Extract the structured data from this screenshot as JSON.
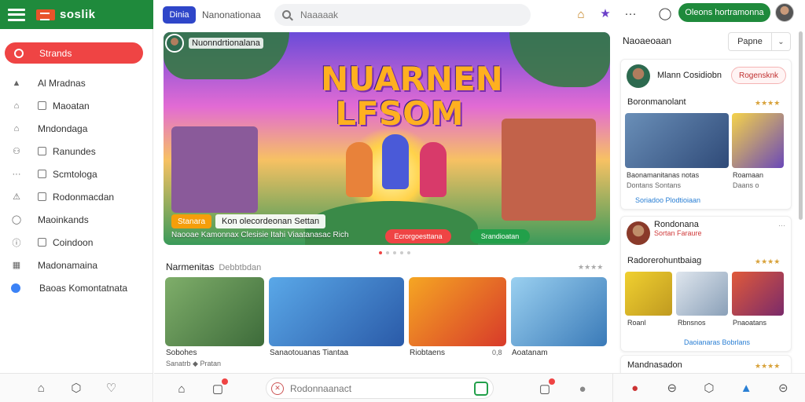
{
  "app": {
    "name": "soslik",
    "colors": {
      "brand_green": "#1f8a3c",
      "accent_red": "#ef4444",
      "accent_blue": "#2f46c9"
    }
  },
  "sidebar": {
    "active": {
      "label": "Strands",
      "icon": "home-icon"
    },
    "items": [
      {
        "label": "Al Mradnas",
        "icon": "person-icon"
      },
      {
        "label": "Maoatan",
        "icon": "building-icon",
        "checkbox": true
      },
      {
        "label": "Mndondaga",
        "icon": "home-outline-icon"
      },
      {
        "label": "Ranundes",
        "icon": "people-icon",
        "checkbox": true
      },
      {
        "label": "Scmtologa",
        "icon": "more-icon",
        "checkbox": true
      },
      {
        "label": "Rodonmacdan",
        "icon": "triangle-icon",
        "checkbox": true
      },
      {
        "label": "Maoinkands",
        "icon": "chat-icon"
      },
      {
        "label": "Coindoon",
        "icon": "info-icon",
        "checkbox": true
      },
      {
        "label": "Madonamaina",
        "icon": "bank-icon"
      },
      {
        "label": "Baoas Komontatnata",
        "icon": "info-blue-icon"
      }
    ]
  },
  "topbar": {
    "badge": "Dinia",
    "brand_text": "Nanonationaa",
    "search_placeholder": "Naaaaak",
    "cta": "Oleons hortramonna"
  },
  "hero": {
    "user": "Nuonndrtionalana",
    "title": "NUARNEN LFSOM",
    "pill": "Stanara",
    "caption": "Kon olecordeonan Settan",
    "desc": "Naooae Kamonnax Clesisie Itahi Viaatanasac Rich",
    "btn_red": "Ecrorgoesttana",
    "btn_green": "Srandioatan"
  },
  "section": {
    "title": "Narmenitas",
    "subtitle": "Debbtbdan",
    "cards": [
      {
        "caption": "Sobohes",
        "sub": "Sanatrb ◆ Pratan"
      },
      {
        "caption": "Sanaotouanas Tiantaa",
        "sub": "0,8"
      },
      {
        "caption": "Riobtaens",
        "sub": ""
      },
      {
        "caption": "Aoatanam",
        "sub": ""
      }
    ]
  },
  "right": {
    "header": "Naoaeoaan",
    "select": "Papne",
    "card1": {
      "user": "Mlann Cosidiobn",
      "follow": "Rogensknk",
      "title": "Boronmanolant",
      "captions": [
        "Baonamanitanas notas",
        "Roamaan"
      ],
      "subs": [
        "Dontans Sontans",
        "Daans o"
      ],
      "meta": "Soriadoo Plodtioiaan"
    },
    "card2": {
      "user": "Rondonana",
      "subline": "Sortan Faraure",
      "title": "Radorerohuntbaiag",
      "captions": [
        "Roanl",
        "Rbnsnos",
        "Pnaoatans"
      ],
      "meta": "Daoianaras Bobrlans"
    },
    "card3": {
      "title": "Mandnasadon"
    }
  },
  "bottom": {
    "input_placeholder": "Rodonnaanact"
  }
}
